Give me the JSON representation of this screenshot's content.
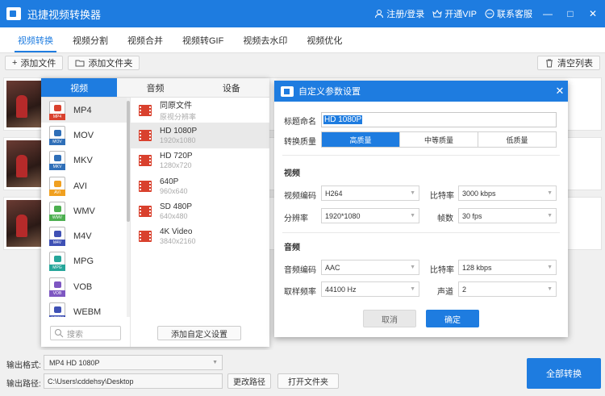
{
  "app": {
    "title": "迅捷视频转换器"
  },
  "titlebar": {
    "login": "注册/登录",
    "vip": "开通VIP",
    "support": "联系客服",
    "min": "—",
    "max": "□",
    "close": "✕"
  },
  "navtabs": [
    "视频转换",
    "视频分割",
    "视频合并",
    "视频转GIF",
    "视频去水印",
    "视频优化"
  ],
  "toolbar": {
    "add_file": "添加文件",
    "add_folder": "添加文件夹",
    "clear_list": "清空列表"
  },
  "format_panel": {
    "tabs": [
      "视频",
      "音频",
      "设备"
    ],
    "formats": [
      {
        "label": "MP4",
        "color": "#d9412e"
      },
      {
        "label": "MOV",
        "color": "#2f6fb8"
      },
      {
        "label": "MKV",
        "color": "#2f6fb8"
      },
      {
        "label": "AVI",
        "color": "#f0a020"
      },
      {
        "label": "WMV",
        "color": "#4caf50"
      },
      {
        "label": "M4V",
        "color": "#3f51b5"
      },
      {
        "label": "MPG",
        "color": "#26a69a"
      },
      {
        "label": "VOB",
        "color": "#7e57c2"
      },
      {
        "label": "WEBM",
        "color": "#3f51b5"
      }
    ],
    "resolutions": [
      {
        "name": "同原文件",
        "sub": "原视分辨率"
      },
      {
        "name": "HD 1080P",
        "sub": "1920x1080"
      },
      {
        "name": "HD 720P",
        "sub": "1280x720"
      },
      {
        "name": "640P",
        "sub": "960x640"
      },
      {
        "name": "SD 480P",
        "sub": "640x480"
      },
      {
        "name": "4K Video",
        "sub": "3840x2160"
      }
    ],
    "search_placeholder": "搜索",
    "custom_button": "添加自定义设置"
  },
  "dialog": {
    "title": "自定义参数设置",
    "name_label": "标题命名",
    "name_value": "HD 1080P",
    "quality_label": "转换质量",
    "quality_options": [
      "高质量",
      "中等质量",
      "低质量"
    ],
    "video_section": "视频",
    "video_codec_label": "视频编码",
    "video_codec": "H264",
    "video_bitrate_label": "比特率",
    "video_bitrate": "3000 kbps",
    "resolution_label": "分辨率",
    "resolution": "1920*1080",
    "fps_label": "帧数",
    "fps": "30 fps",
    "audio_section": "音频",
    "audio_codec_label": "音频编码",
    "audio_codec": "AAC",
    "audio_bitrate_label": "比特率",
    "audio_bitrate": "128 kbps",
    "sample_rate_label": "取样频率",
    "sample_rate": "44100 Hz",
    "channel_label": "声道",
    "channel": "2",
    "cancel": "取消",
    "ok": "确定"
  },
  "bottom": {
    "format_label": "输出格式:",
    "format_value": "MP4  HD 1080P",
    "path_label": "输出路径:",
    "path_value": "C:\\Users\\cddehsy\\Desktop",
    "change_path": "更改路径",
    "open_folder": "打开文件夹",
    "convert_all": "全部转换"
  }
}
